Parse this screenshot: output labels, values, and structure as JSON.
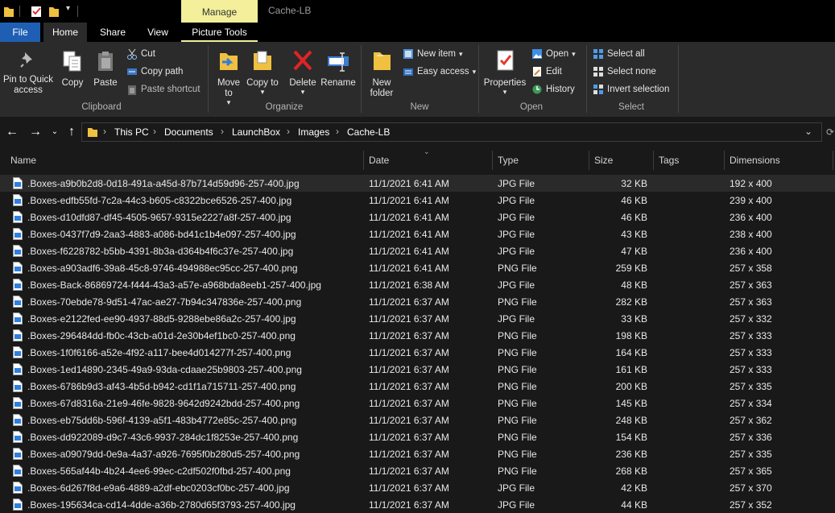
{
  "window": {
    "title": "Cache-LB",
    "manage_label": "Manage"
  },
  "tabs": [
    {
      "label": "File"
    },
    {
      "label": "Home"
    },
    {
      "label": "Share"
    },
    {
      "label": "View"
    },
    {
      "label": "Picture Tools"
    }
  ],
  "ribbon": {
    "pin_label": "Pin to Quick access",
    "copy_label": "Copy",
    "paste_label": "Paste",
    "cut_label": "Cut",
    "copy_path_label": "Copy path",
    "paste_shortcut_label": "Paste shortcut",
    "clipboard_group": "Clipboard",
    "move_to_label": "Move to",
    "copy_to_label": "Copy to",
    "delete_label": "Delete",
    "rename_label": "Rename",
    "organize_group": "Organize",
    "new_folder_label": "New folder",
    "new_item_label": "New item",
    "easy_access_label": "Easy access",
    "new_group": "New",
    "properties_label": "Properties",
    "open_label": "Open",
    "edit_label": "Edit",
    "history_label": "History",
    "open_group": "Open",
    "select_all_label": "Select all",
    "select_none_label": "Select none",
    "invert_selection_label": "Invert selection",
    "select_group": "Select"
  },
  "breadcrumb": [
    "This PC",
    "Documents",
    "LaunchBox",
    "Images",
    "Cache-LB"
  ],
  "columns": {
    "name": "Name",
    "date": "Date",
    "type": "Type",
    "size": "Size",
    "tags": "Tags",
    "dimensions": "Dimensions"
  },
  "files": [
    {
      "name": ".Boxes-a9b0b2d8-0d18-491a-a45d-87b714d59d96-257-400.jpg",
      "date": "11/1/2021 6:41 AM",
      "type": "JPG File",
      "size": "32 KB",
      "dimensions": "192 x 400"
    },
    {
      "name": ".Boxes-edfb55fd-7c2a-44c3-b605-c8322bce6526-257-400.jpg",
      "date": "11/1/2021 6:41 AM",
      "type": "JPG File",
      "size": "46 KB",
      "dimensions": "239 x 400"
    },
    {
      "name": ".Boxes-d10dfd87-df45-4505-9657-9315e2227a8f-257-400.jpg",
      "date": "11/1/2021 6:41 AM",
      "type": "JPG File",
      "size": "46 KB",
      "dimensions": "236 x 400"
    },
    {
      "name": ".Boxes-0437f7d9-2aa3-4883-a086-bd41c1b4e097-257-400.jpg",
      "date": "11/1/2021 6:41 AM",
      "type": "JPG File",
      "size": "43 KB",
      "dimensions": "238 x 400"
    },
    {
      "name": ".Boxes-f6228782-b5bb-4391-8b3a-d364b4f6c37e-257-400.jpg",
      "date": "11/1/2021 6:41 AM",
      "type": "JPG File",
      "size": "47 KB",
      "dimensions": "236 x 400"
    },
    {
      "name": ".Boxes-a903adf6-39a8-45c8-9746-494988ec95cc-257-400.png",
      "date": "11/1/2021 6:41 AM",
      "type": "PNG File",
      "size": "259 KB",
      "dimensions": "257 x 358"
    },
    {
      "name": ".Boxes-Back-86869724-f444-43a3-a57e-a968bda8eeb1-257-400.jpg",
      "date": "11/1/2021 6:38 AM",
      "type": "JPG File",
      "size": "48 KB",
      "dimensions": "257 x 363"
    },
    {
      "name": ".Boxes-70ebde78-9d51-47ac-ae27-7b94c347836e-257-400.png",
      "date": "11/1/2021 6:37 AM",
      "type": "PNG File",
      "size": "282 KB",
      "dimensions": "257 x 363"
    },
    {
      "name": ".Boxes-e2122fed-ee90-4937-88d5-9288ebe86a2c-257-400.jpg",
      "date": "11/1/2021 6:37 AM",
      "type": "JPG File",
      "size": "33 KB",
      "dimensions": "257 x 332"
    },
    {
      "name": ".Boxes-296484dd-fb0c-43cb-a01d-2e30b4ef1bc0-257-400.png",
      "date": "11/1/2021 6:37 AM",
      "type": "PNG File",
      "size": "198 KB",
      "dimensions": "257 x 333"
    },
    {
      "name": ".Boxes-1f0f6166-a52e-4f92-a117-bee4d014277f-257-400.png",
      "date": "11/1/2021 6:37 AM",
      "type": "PNG File",
      "size": "164 KB",
      "dimensions": "257 x 333"
    },
    {
      "name": ".Boxes-1ed14890-2345-49a9-93da-cdaae25b9803-257-400.png",
      "date": "11/1/2021 6:37 AM",
      "type": "PNG File",
      "size": "161 KB",
      "dimensions": "257 x 333"
    },
    {
      "name": ".Boxes-6786b9d3-af43-4b5d-b942-cd1f1a715711-257-400.png",
      "date": "11/1/2021 6:37 AM",
      "type": "PNG File",
      "size": "200 KB",
      "dimensions": "257 x 335"
    },
    {
      "name": ".Boxes-67d8316a-21e9-46fe-9828-9642d9242bdd-257-400.png",
      "date": "11/1/2021 6:37 AM",
      "type": "PNG File",
      "size": "145 KB",
      "dimensions": "257 x 334"
    },
    {
      "name": ".Boxes-eb75dd6b-596f-4139-a5f1-483b4772e85c-257-400.png",
      "date": "11/1/2021 6:37 AM",
      "type": "PNG File",
      "size": "248 KB",
      "dimensions": "257 x 362"
    },
    {
      "name": ".Boxes-dd922089-d9c7-43c6-9937-284dc1f8253e-257-400.png",
      "date": "11/1/2021 6:37 AM",
      "type": "PNG File",
      "size": "154 KB",
      "dimensions": "257 x 336"
    },
    {
      "name": ".Boxes-a09079dd-0e9a-4a37-a926-7695f0b280d5-257-400.png",
      "date": "11/1/2021 6:37 AM",
      "type": "PNG File",
      "size": "236 KB",
      "dimensions": "257 x 335"
    },
    {
      "name": ".Boxes-565af44b-4b24-4ee6-99ec-c2df502f0fbd-257-400.png",
      "date": "11/1/2021 6:37 AM",
      "type": "PNG File",
      "size": "268 KB",
      "dimensions": "257 x 365"
    },
    {
      "name": ".Boxes-6d267f8d-e9a6-4889-a2df-ebc0203cf0bc-257-400.jpg",
      "date": "11/1/2021 6:37 AM",
      "type": "JPG File",
      "size": "42 KB",
      "dimensions": "257 x 370"
    },
    {
      "name": ".Boxes-195634ca-cd14-4dde-a36b-2780d65f3793-257-400.jpg",
      "date": "11/1/2021 6:37 AM",
      "type": "JPG File",
      "size": "44 KB",
      "dimensions": "257 x 352"
    }
  ]
}
